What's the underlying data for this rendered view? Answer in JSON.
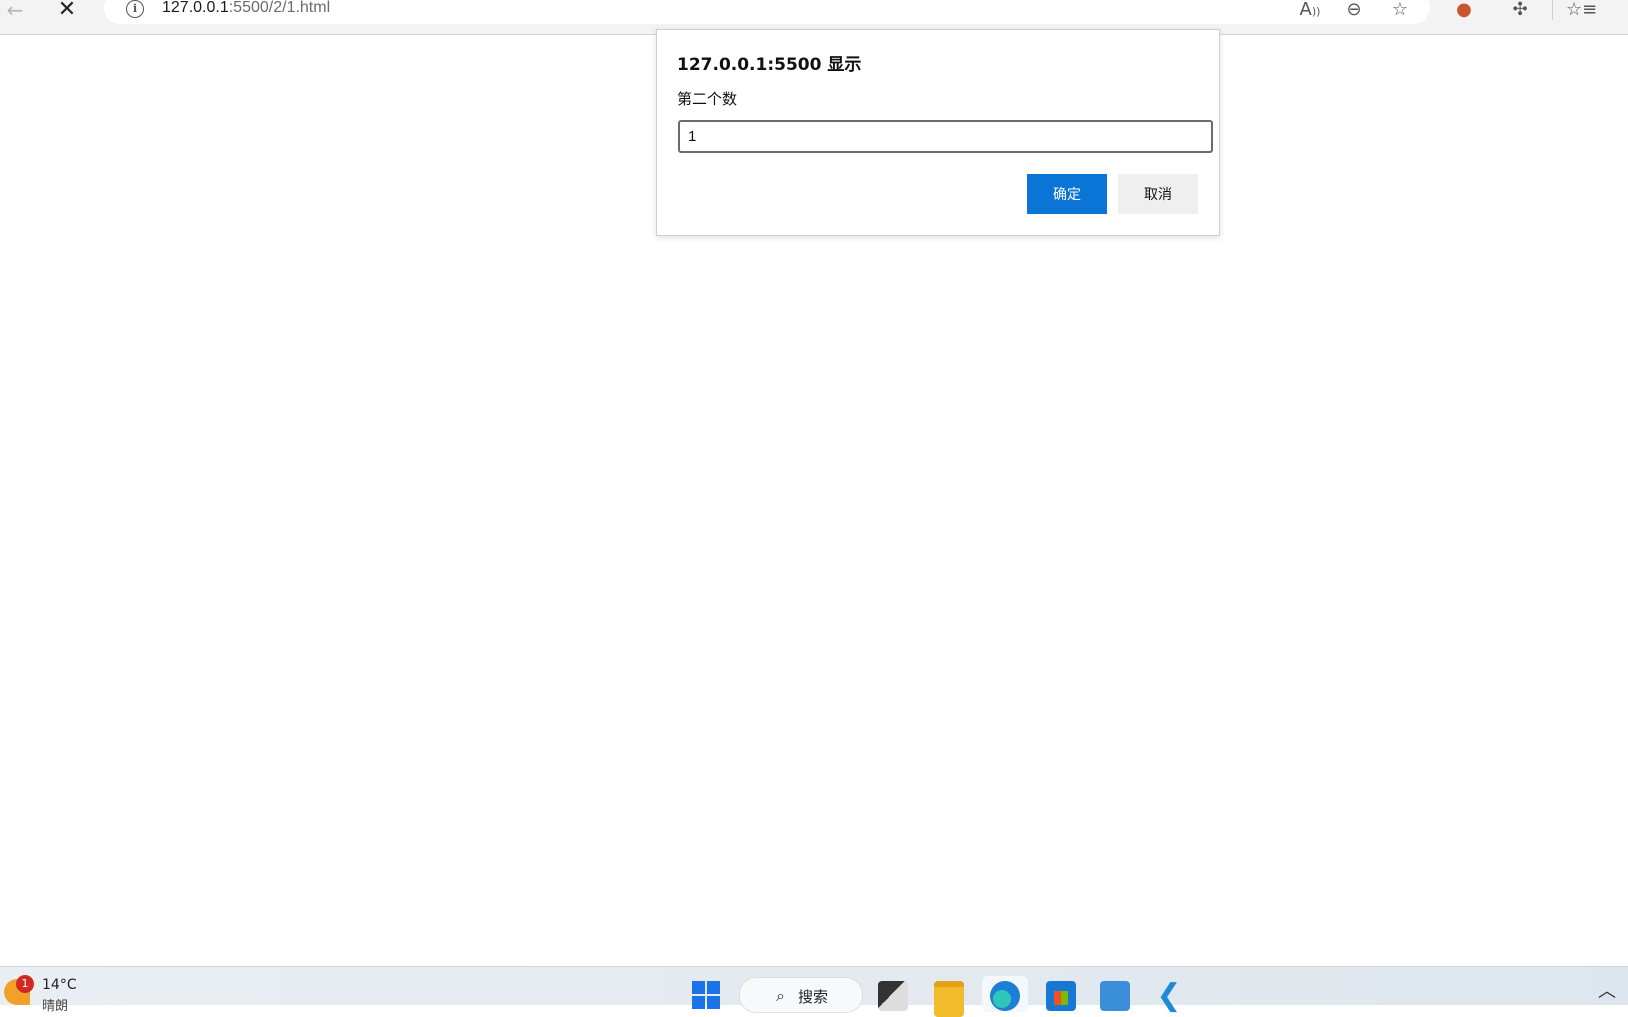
{
  "browser": {
    "url_host": "127.0.0.1",
    "url_rest": ":5500/2/1.html",
    "back_glyph": "←",
    "stop_glyph": "✕",
    "info_glyph": "i",
    "toolbar_icons": [
      "read-aloud-icon",
      "zoom-out-icon",
      "add-favorite-icon",
      "extension-monkey-icon",
      "extensions-icon",
      "favorites-icon"
    ]
  },
  "dialog": {
    "title": "127.0.0.1:5500 显示",
    "message": "第二个数",
    "input_value": "1",
    "ok_label": "确定",
    "cancel_label": "取消",
    "ok_color": "#0b74d7"
  },
  "taskbar": {
    "weather_badge": "1",
    "weather_temp": "14°C",
    "weather_desc": "晴朗",
    "search_label": "搜索",
    "apps": [
      "start-icon",
      "task-view-icon",
      "file-explorer-icon",
      "edge-icon",
      "store-icon",
      "app-icon",
      "vscode-icon"
    ]
  }
}
